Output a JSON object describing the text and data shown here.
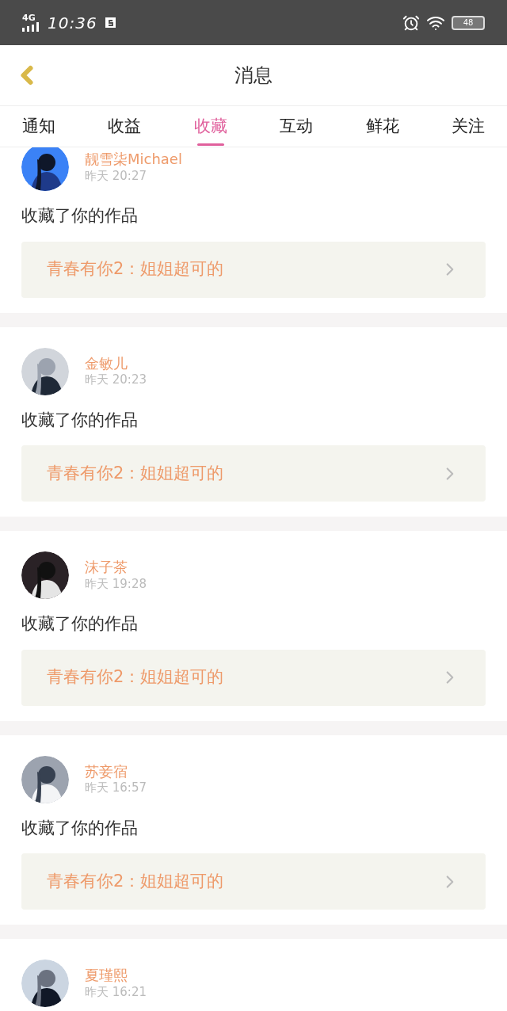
{
  "status_bar": {
    "network": "4G",
    "time": "10:36",
    "battery": "48"
  },
  "header": {
    "title": "消息"
  },
  "tabs": [
    {
      "label": "通知",
      "selected": false
    },
    {
      "label": "收益",
      "selected": false
    },
    {
      "label": "收藏",
      "selected": true
    },
    {
      "label": "互动",
      "selected": false
    },
    {
      "label": "鲜花",
      "selected": false
    },
    {
      "label": "关注",
      "selected": false
    }
  ],
  "messages": [
    {
      "name": "靓雪柒Michael",
      "time": "昨天 20:27",
      "text": "收藏了你的作品",
      "work": "青春有你2：姐姐超可的"
    },
    {
      "name": "金敏儿",
      "time": "昨天 20:23",
      "text": "收藏了你的作品",
      "work": "青春有你2：姐姐超可的"
    },
    {
      "name": "沫子茶",
      "time": "昨天 19:28",
      "text": "收藏了你的作品",
      "work": "青春有你2：姐姐超可的"
    },
    {
      "name": "苏妾宿",
      "time": "昨天 16:57",
      "text": "收藏了你的作品",
      "work": "青春有你2：姐姐超可的"
    },
    {
      "name": "夏瑾熙",
      "time": "昨天 16:21"
    }
  ]
}
